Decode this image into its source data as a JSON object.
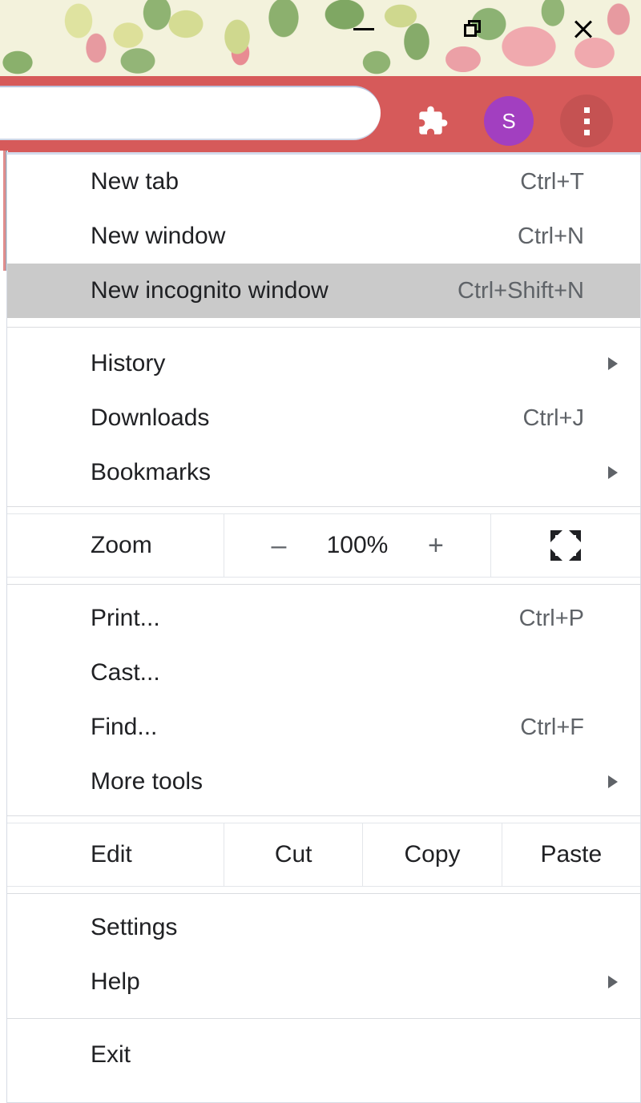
{
  "window_controls": {
    "minimize": "minimize-icon",
    "restore": "restore-icon",
    "close": "close-icon"
  },
  "toolbar": {
    "omnibox_value": "",
    "omnibox_placeholder": "",
    "extensions_icon": "puzzle-piece-icon",
    "profile_initial": "S",
    "menu_icon": "three-dot-menu-icon",
    "background_color": "#d65a5a",
    "profile_color": "#a23fc0"
  },
  "menu": {
    "highlight_color": "#cacaca",
    "sections": [
      {
        "type": "items",
        "items": [
          {
            "label": "New tab",
            "shortcut": "Ctrl+T",
            "submenu": false,
            "highlighted": false
          },
          {
            "label": "New window",
            "shortcut": "Ctrl+N",
            "submenu": false,
            "highlighted": false
          },
          {
            "label": "New incognito window",
            "shortcut": "Ctrl+Shift+N",
            "submenu": false,
            "highlighted": true
          }
        ]
      },
      {
        "type": "items",
        "items": [
          {
            "label": "History",
            "shortcut": "",
            "submenu": true,
            "highlighted": false
          },
          {
            "label": "Downloads",
            "shortcut": "Ctrl+J",
            "submenu": false,
            "highlighted": false
          },
          {
            "label": "Bookmarks",
            "shortcut": "",
            "submenu": true,
            "highlighted": false
          }
        ]
      },
      {
        "type": "zoom",
        "label": "Zoom",
        "minus": "–",
        "percent": "100%",
        "plus": "+",
        "fullscreen_icon": "fullscreen-icon"
      },
      {
        "type": "items",
        "items": [
          {
            "label": "Print...",
            "shortcut": "Ctrl+P",
            "submenu": false,
            "highlighted": false
          },
          {
            "label": "Cast...",
            "shortcut": "",
            "submenu": false,
            "highlighted": false
          },
          {
            "label": "Find...",
            "shortcut": "Ctrl+F",
            "submenu": false,
            "highlighted": false
          },
          {
            "label": "More tools",
            "shortcut": "",
            "submenu": true,
            "highlighted": false
          }
        ]
      },
      {
        "type": "edit",
        "label": "Edit",
        "actions": [
          "Cut",
          "Copy",
          "Paste"
        ]
      },
      {
        "type": "items",
        "items": [
          {
            "label": "Settings",
            "shortcut": "",
            "submenu": false,
            "highlighted": false
          },
          {
            "label": "Help",
            "shortcut": "",
            "submenu": true,
            "highlighted": false
          }
        ]
      },
      {
        "type": "items",
        "items": [
          {
            "label": "Exit",
            "shortcut": "",
            "submenu": false,
            "highlighted": false
          }
        ]
      }
    ]
  }
}
